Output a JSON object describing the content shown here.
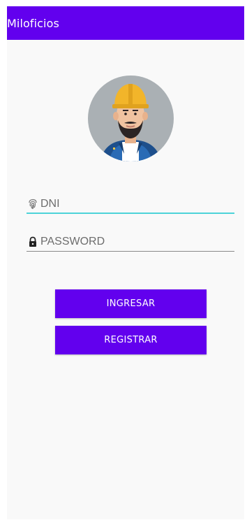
{
  "app_bar": {
    "title": "Miloficios",
    "color": "#6200ee"
  },
  "avatar": {
    "icon": "worker-avatar-icon"
  },
  "form": {
    "dni": {
      "placeholder": "DNI",
      "value": "",
      "icon": "fingerprint-icon",
      "underline_color": "#4dd3d8"
    },
    "password": {
      "placeholder": "PASSWORD",
      "value": "",
      "icon": "lock-icon",
      "underline_color": "#8a8a8a"
    }
  },
  "buttons": {
    "ingresar_label": "INGRESAR",
    "registrar_label": "REGISTRAR",
    "color": "#6200ee"
  }
}
